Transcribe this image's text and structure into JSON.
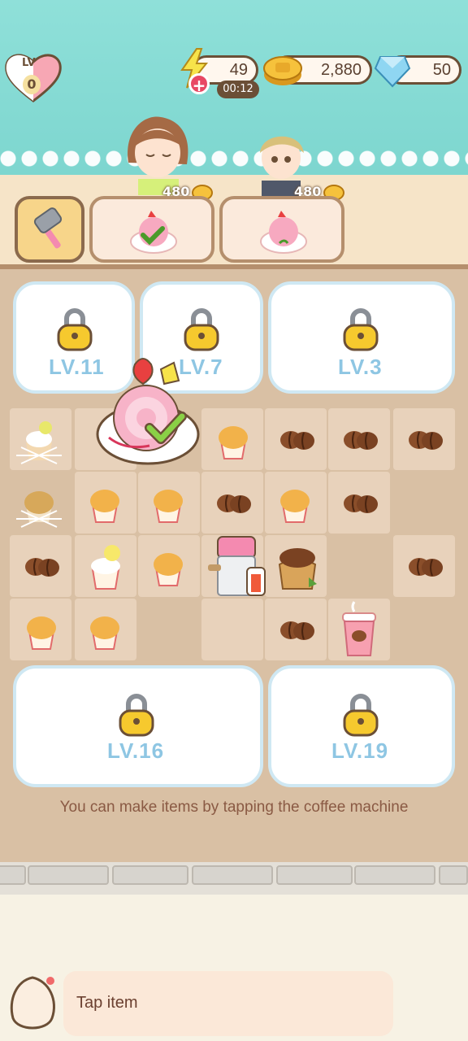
{
  "hud": {
    "level_label": "LV",
    "level_value": "0",
    "energy": "49",
    "energy_timer": "00:12",
    "coins": "2,880",
    "gems": "50"
  },
  "customers": [
    {
      "reward": "480"
    },
    {
      "reward": "480"
    }
  ],
  "locked_areas": [
    {
      "label": "LV.11"
    },
    {
      "label": "LV.7"
    },
    {
      "label": "LV.3"
    },
    {
      "label": "LV.16"
    },
    {
      "label": "LV.19"
    }
  ],
  "hint": "You can make items by tapping the coffee machine",
  "tip": "Tap item",
  "colors": {
    "accent": "#f7d58a",
    "border": "#b58f6d",
    "lock_text": "#8ec6e3"
  }
}
